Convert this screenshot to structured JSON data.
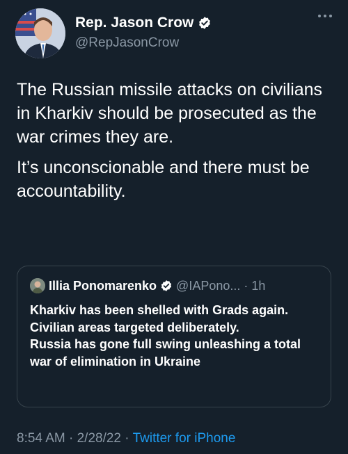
{
  "author": {
    "display_name": "Rep. Jason Crow",
    "handle": "@RepJasonCrow",
    "verified_icon": "verified-badge-icon"
  },
  "more_icon": "more-options-icon",
  "tweet": {
    "paragraphs": [
      "The Russian missile attacks on civilians in Kharkiv should be prosecuted as the war crimes they are.",
      "It’s unconscionable and there must be accountability."
    ]
  },
  "quoted_tweet": {
    "display_name": "Illia Ponomarenko",
    "handle": "@IAPono...",
    "separator": "·",
    "time": "1h",
    "text": "Kharkiv has been shelled with Grads again. Civilian areas targeted deliberately.\nRussia has gone full swing unleashing a total war of elimination in Ukraine"
  },
  "meta": {
    "time": "8:54 AM",
    "separator_1": "·",
    "date": "2/28/22",
    "separator_2": "·",
    "source": "Twitter for iPhone"
  },
  "colors": {
    "background": "#15202b",
    "text": "#ffffff",
    "secondary_text": "#8b98a5",
    "accent": "#1d9bf0",
    "border": "#38444d"
  }
}
